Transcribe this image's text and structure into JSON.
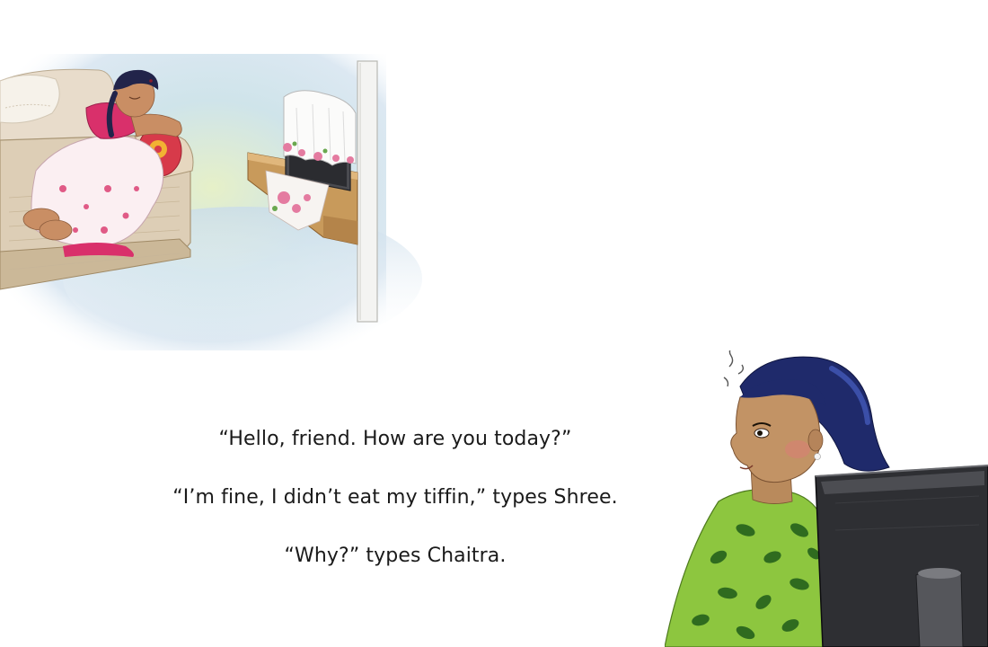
{
  "story": {
    "lines": [
      "“Hello, friend. How are you today?”",
      "“I’m fine, I didn’t eat my tiffin,” types Shree.",
      "“Why?” types Chaitra."
    ]
  },
  "illustrations": {
    "top": "woman-sleeping-on-sofa-illustration",
    "bottom": "girl-at-computer-illustration"
  },
  "colors": {
    "background": "#ffffff",
    "text": "#1a1a1a",
    "sari_pink": "#d9306b",
    "blouse_green": "#8dc63f",
    "monitor_dark": "#2e2f33"
  }
}
